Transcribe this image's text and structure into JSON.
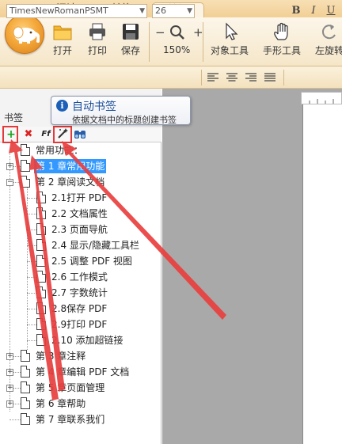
{
  "tabs": [
    {
      "label": "阅读"
    },
    {
      "label": "转换"
    },
    {
      "label": "编辑"
    }
  ],
  "toolbar": {
    "open": "打开",
    "print": "打印",
    "save": "保存",
    "zoom_minus": "−",
    "zoom_plus": "+",
    "zoom": "150%",
    "object_tool": "对象工具",
    "hand_tool": "手形工具",
    "rotate": "左旋转"
  },
  "font": {
    "family": "TimesNewRomanPSMT",
    "size": "26",
    "bold": "B",
    "italic": "I",
    "underline": "U"
  },
  "panel": {
    "title": "书签",
    "tools": {
      "add": "+",
      "delete": "✖",
      "font": "Ff"
    }
  },
  "tooltip": {
    "title": "自动书签",
    "desc": "依据文档中的标题创建书签",
    "icon": "i"
  },
  "bookmarks": {
    "common": "常用功能：",
    "ch1": "第 1 章常用功能",
    "ch2": "第 2 章阅读文档",
    "ch2_items": [
      "2.1打开 PDF",
      "2.2 文档属性",
      "2.3 页面导航",
      "2.4 显示/隐藏工具栏",
      "2.5 调整 PDF 视图",
      "2.6 工作模式",
      "2.7 字数统计",
      "2.8保存 PDF",
      "2.9打印 PDF",
      "2.10 添加超链接"
    ],
    "ch3": "第 3 章注释",
    "ch4": "第 4 章编辑 PDF 文档",
    "ch5": "第 5 章页面管理",
    "ch6": "第 6 章帮助",
    "ch7": "第 7 章联系我们"
  },
  "colors": {
    "accent": "#f4a83a",
    "selection": "#3399ff",
    "annotation": "#e23a3a"
  }
}
